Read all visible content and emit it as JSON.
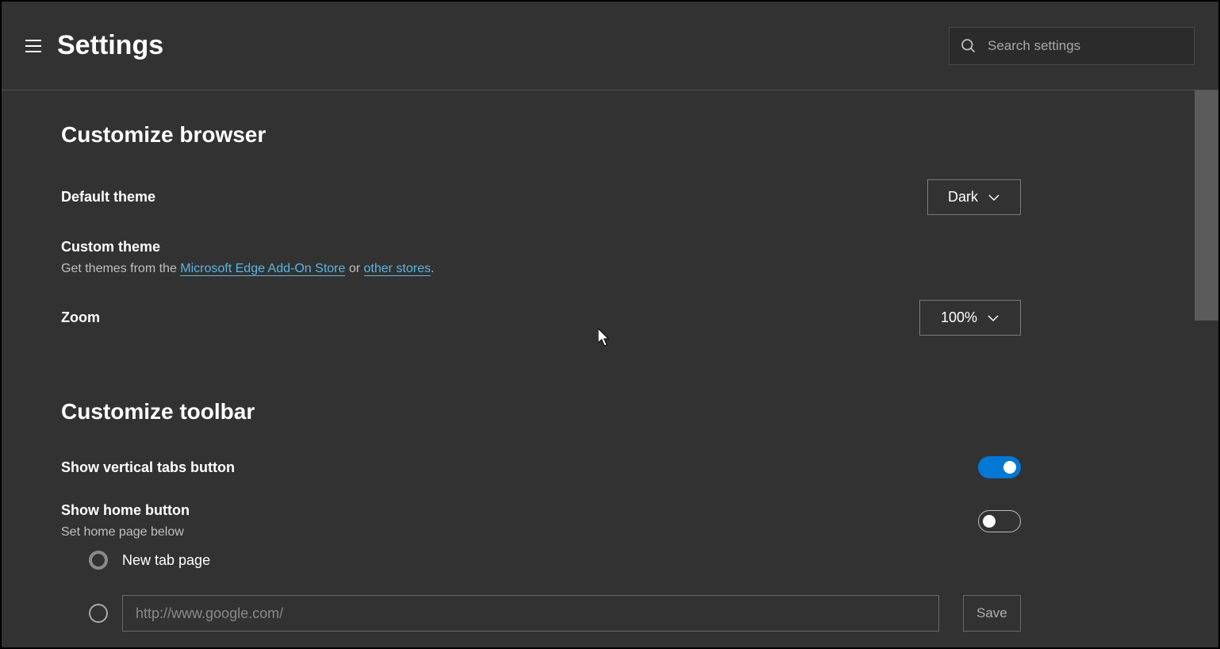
{
  "header": {
    "title": "Settings",
    "search_placeholder": "Search settings"
  },
  "sections": {
    "customize_browser": {
      "heading": "Customize browser",
      "default_theme": {
        "label": "Default theme",
        "value": "Dark"
      },
      "custom_theme": {
        "label": "Custom theme",
        "desc_prefix": "Get themes from the ",
        "link1": "Microsoft Edge Add-On Store",
        "desc_mid": " or ",
        "link2": "other stores",
        "desc_suffix": "."
      },
      "zoom": {
        "label": "Zoom",
        "value": "100%"
      }
    },
    "customize_toolbar": {
      "heading": "Customize toolbar",
      "vertical_tabs": {
        "label": "Show vertical tabs button"
      },
      "home_button": {
        "label": "Show home button",
        "subtitle": "Set home page below"
      },
      "home_options": {
        "new_tab": "New tab page",
        "url_placeholder": "http://www.google.com/",
        "save": "Save"
      }
    }
  }
}
